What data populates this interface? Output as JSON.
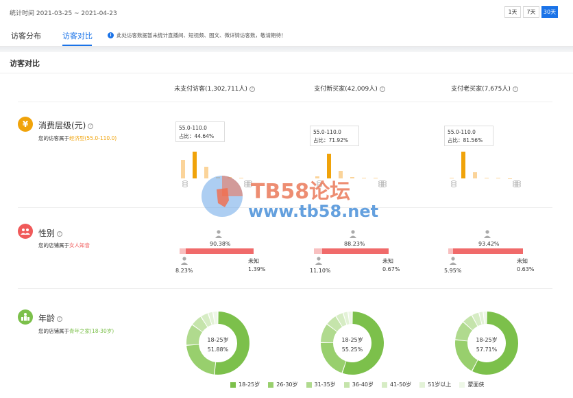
{
  "header": {
    "period": "统计时间 2021-03-25 ~ 2021-04-23",
    "range_buttons": [
      "1天",
      "7天",
      "30天"
    ],
    "active_range": "30天"
  },
  "tabs": [
    {
      "label": "访客分布",
      "active": false
    },
    {
      "label": "访客对比",
      "active": true
    }
  ],
  "notice": "此处访客数据暂未统计直播间、短视频、图文、微详情访客数，敬请期待！",
  "section_title": "访客对比",
  "columns": [
    {
      "label": "未支付访客(1,302,711人)"
    },
    {
      "label": "支付新买家(42,009人)"
    },
    {
      "label": "支付老买家(7,675人)"
    }
  ],
  "consumption": {
    "title": "消费层级(元)",
    "desc_prefix": "您的访客属于",
    "desc_highlight": "经济型(55.0-110.0)",
    "icon": "yen-icon",
    "color": "#f0a30a",
    "charts": [
      {
        "tip_range": "55.0-110.0",
        "tip_share": "占比：44.64%",
        "bars": [
          0.55,
          0.78,
          0.35,
          0.05,
          0.04,
          0.03
        ]
      },
      {
        "tip_range": "55.0-110.0",
        "tip_share": "占比：71.92%",
        "bars": [
          0.06,
          0.72,
          0.22,
          0.04,
          0.03,
          0.02
        ]
      },
      {
        "tip_range": "55.0-110.0",
        "tip_share": "占比：81.56%",
        "bars": [
          0.03,
          0.78,
          0.18,
          0.02,
          0.02,
          0.01
        ]
      }
    ]
  },
  "gender": {
    "title": "性别",
    "desc_prefix": "您的店铺属于",
    "desc_highlight": "女人知音",
    "icon": "people-icon",
    "color": "#f05a5a",
    "unknown_label": "未知",
    "charts": [
      {
        "female": "90.38%",
        "male": "8.23%",
        "unknown": "1.39%",
        "female_v": 90.38,
        "male_v": 8.23
      },
      {
        "female": "88.23%",
        "male": "11.10%",
        "unknown": "0.67%",
        "female_v": 88.23,
        "male_v": 11.1
      },
      {
        "female": "93.42%",
        "male": "5.95%",
        "unknown": "0.63%",
        "female_v": 93.42,
        "male_v": 5.95
      }
    ]
  },
  "age": {
    "title": "年龄",
    "desc_prefix": "您的店铺属于",
    "desc_highlight": "青年之家(18-30岁)",
    "icon": "family-icon",
    "color": "#7cc04b",
    "charts": [
      {
        "center_label": "18-25岁",
        "center_value": "51.88%",
        "slices": [
          51.88,
          22,
          11,
          6,
          4,
          2.5,
          2.62
        ]
      },
      {
        "center_label": "18-25岁",
        "center_value": "55.25%",
        "slices": [
          55.25,
          20,
          10,
          6,
          4,
          2.5,
          2.25
        ]
      },
      {
        "center_label": "18-25岁",
        "center_value": "57.71%",
        "slices": [
          57.71,
          19,
          10,
          5.5,
          3.8,
          2.2,
          1.79
        ]
      }
    ],
    "legend": [
      "18-25岁",
      "26-30岁",
      "31-35岁",
      "36-40岁",
      "41-50岁",
      "51岁以上",
      "蒙面侠"
    ],
    "legend_colors": [
      "#7cc04b",
      "#98cf6d",
      "#b0da8e",
      "#c5e4ab",
      "#d6ecc4",
      "#e3f2d7",
      "#eef7e7"
    ]
  },
  "watermark": {
    "line1": "TB58论坛",
    "line2": "www.tb58.net"
  }
}
